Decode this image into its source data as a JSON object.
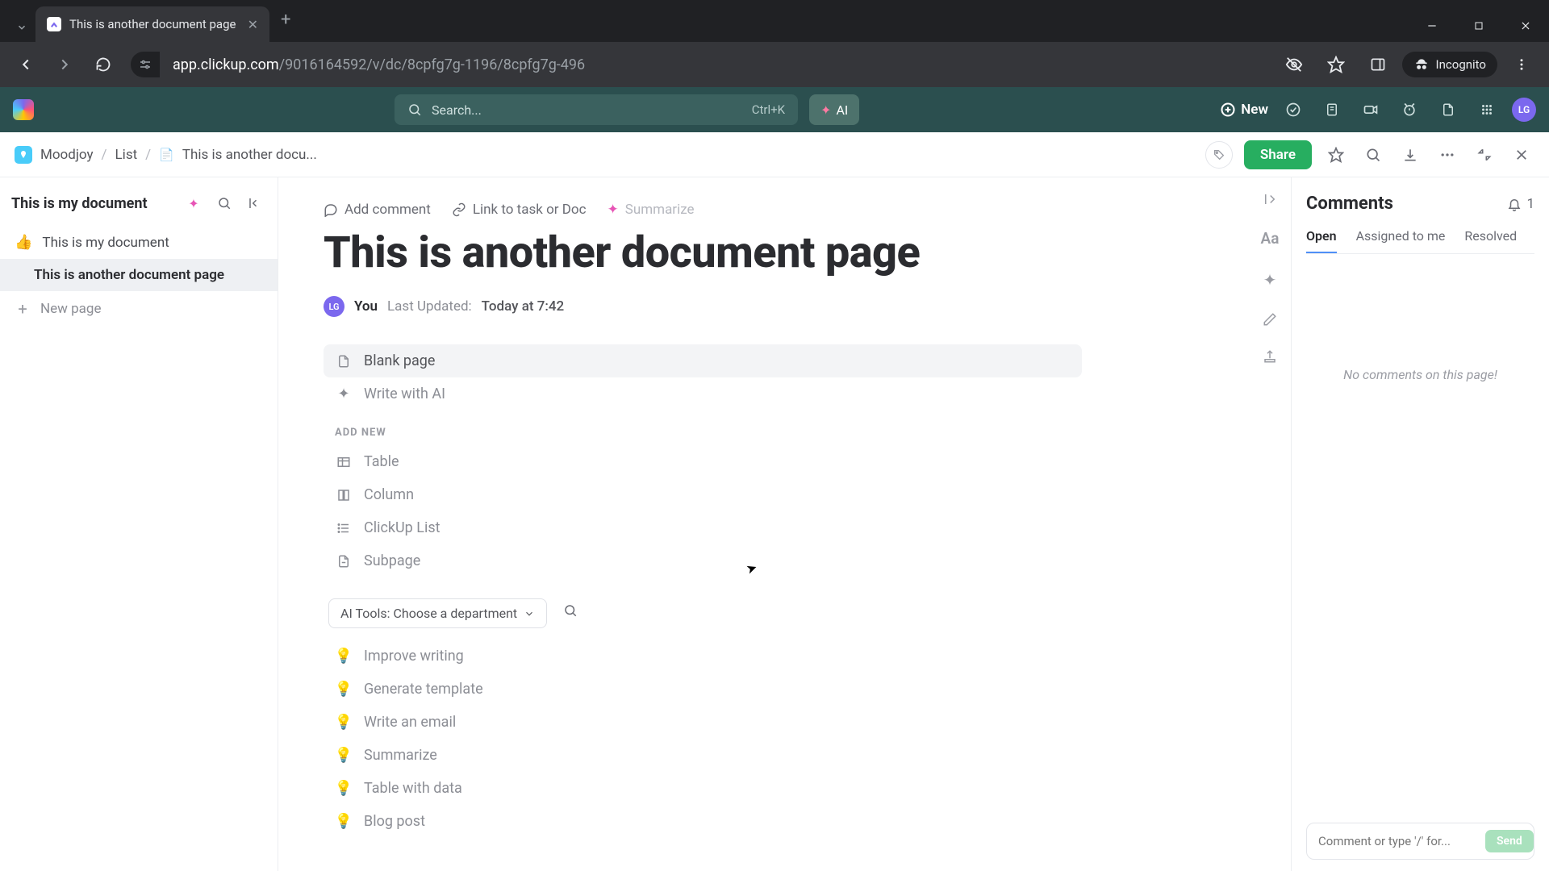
{
  "chrome": {
    "tab_title": "This is another document page",
    "url_domain": "app.clickup.com",
    "url_path": "/9016164592/v/dc/8cpfg7g-1196/8cpfg7g-496",
    "incognito": "Incognito"
  },
  "app_header": {
    "search_placeholder": "Search...",
    "search_kbd": "Ctrl+K",
    "ai_label": "AI",
    "new_label": "New",
    "avatar_initials": "LG"
  },
  "breadcrumb": {
    "workspace": "Moodjoy",
    "list": "List",
    "doc": "This is another docu...",
    "share": "Share"
  },
  "sidebar": {
    "title": "This is my document",
    "items": [
      {
        "emoji": "👍",
        "label": "This is my document"
      },
      {
        "label": "This is another document page"
      }
    ],
    "new_page": "New page"
  },
  "doc": {
    "actions": {
      "add_comment": "Add comment",
      "link": "Link to task or Doc",
      "summarize": "Summarize"
    },
    "title": "This is another document page",
    "author": {
      "initials": "LG",
      "name": "You"
    },
    "updated_label": "Last Updated:",
    "updated_value": "Today at 7:42",
    "options": {
      "blank": "Blank page",
      "write_ai": "Write with AI"
    },
    "add_new_label": "ADD NEW",
    "add_new": {
      "table": "Table",
      "column": "Column",
      "list": "ClickUp List",
      "subpage": "Subpage"
    },
    "ai_dept": "AI Tools: Choose a department",
    "ai_tools": {
      "improve": "Improve writing",
      "template": "Generate template",
      "email": "Write an email",
      "summarize": "Summarize",
      "table_data": "Table with data",
      "blog": "Blog post"
    }
  },
  "comments": {
    "title": "Comments",
    "count": "1",
    "tabs": {
      "open": "Open",
      "assigned": "Assigned to me",
      "resolved": "Resolved"
    },
    "empty": "No comments on this page!",
    "placeholder": "Comment or type '/' for...",
    "send": "Send"
  }
}
